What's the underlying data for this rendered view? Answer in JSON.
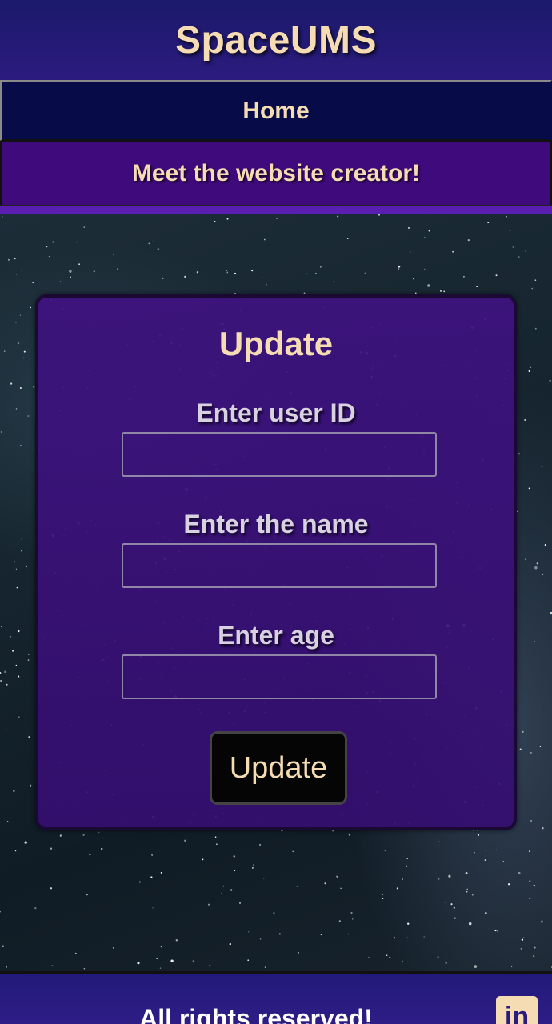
{
  "header": {
    "title": "SpaceUMS"
  },
  "nav": {
    "items": [
      {
        "label": "Home"
      },
      {
        "label": "Meet the website creator!"
      }
    ]
  },
  "form": {
    "title": "Update",
    "fields": [
      {
        "label": "Enter user ID",
        "value": "",
        "placeholder": ""
      },
      {
        "label": "Enter the name",
        "value": "",
        "placeholder": ""
      },
      {
        "label": "Enter age",
        "value": "",
        "placeholder": ""
      }
    ],
    "submit_label": "Update"
  },
  "footer": {
    "text": "All rights reserved!",
    "social_icon": "linkedin-icon",
    "social_icon_text": "in"
  },
  "colors": {
    "accent_text": "#f6dcb2",
    "header_bg": "#2b1b7e",
    "nav_home_bg": "#070c48",
    "nav_creator_bg": "#3f0a7c",
    "card_bg": "#3e1280",
    "button_bg": "#050505"
  }
}
